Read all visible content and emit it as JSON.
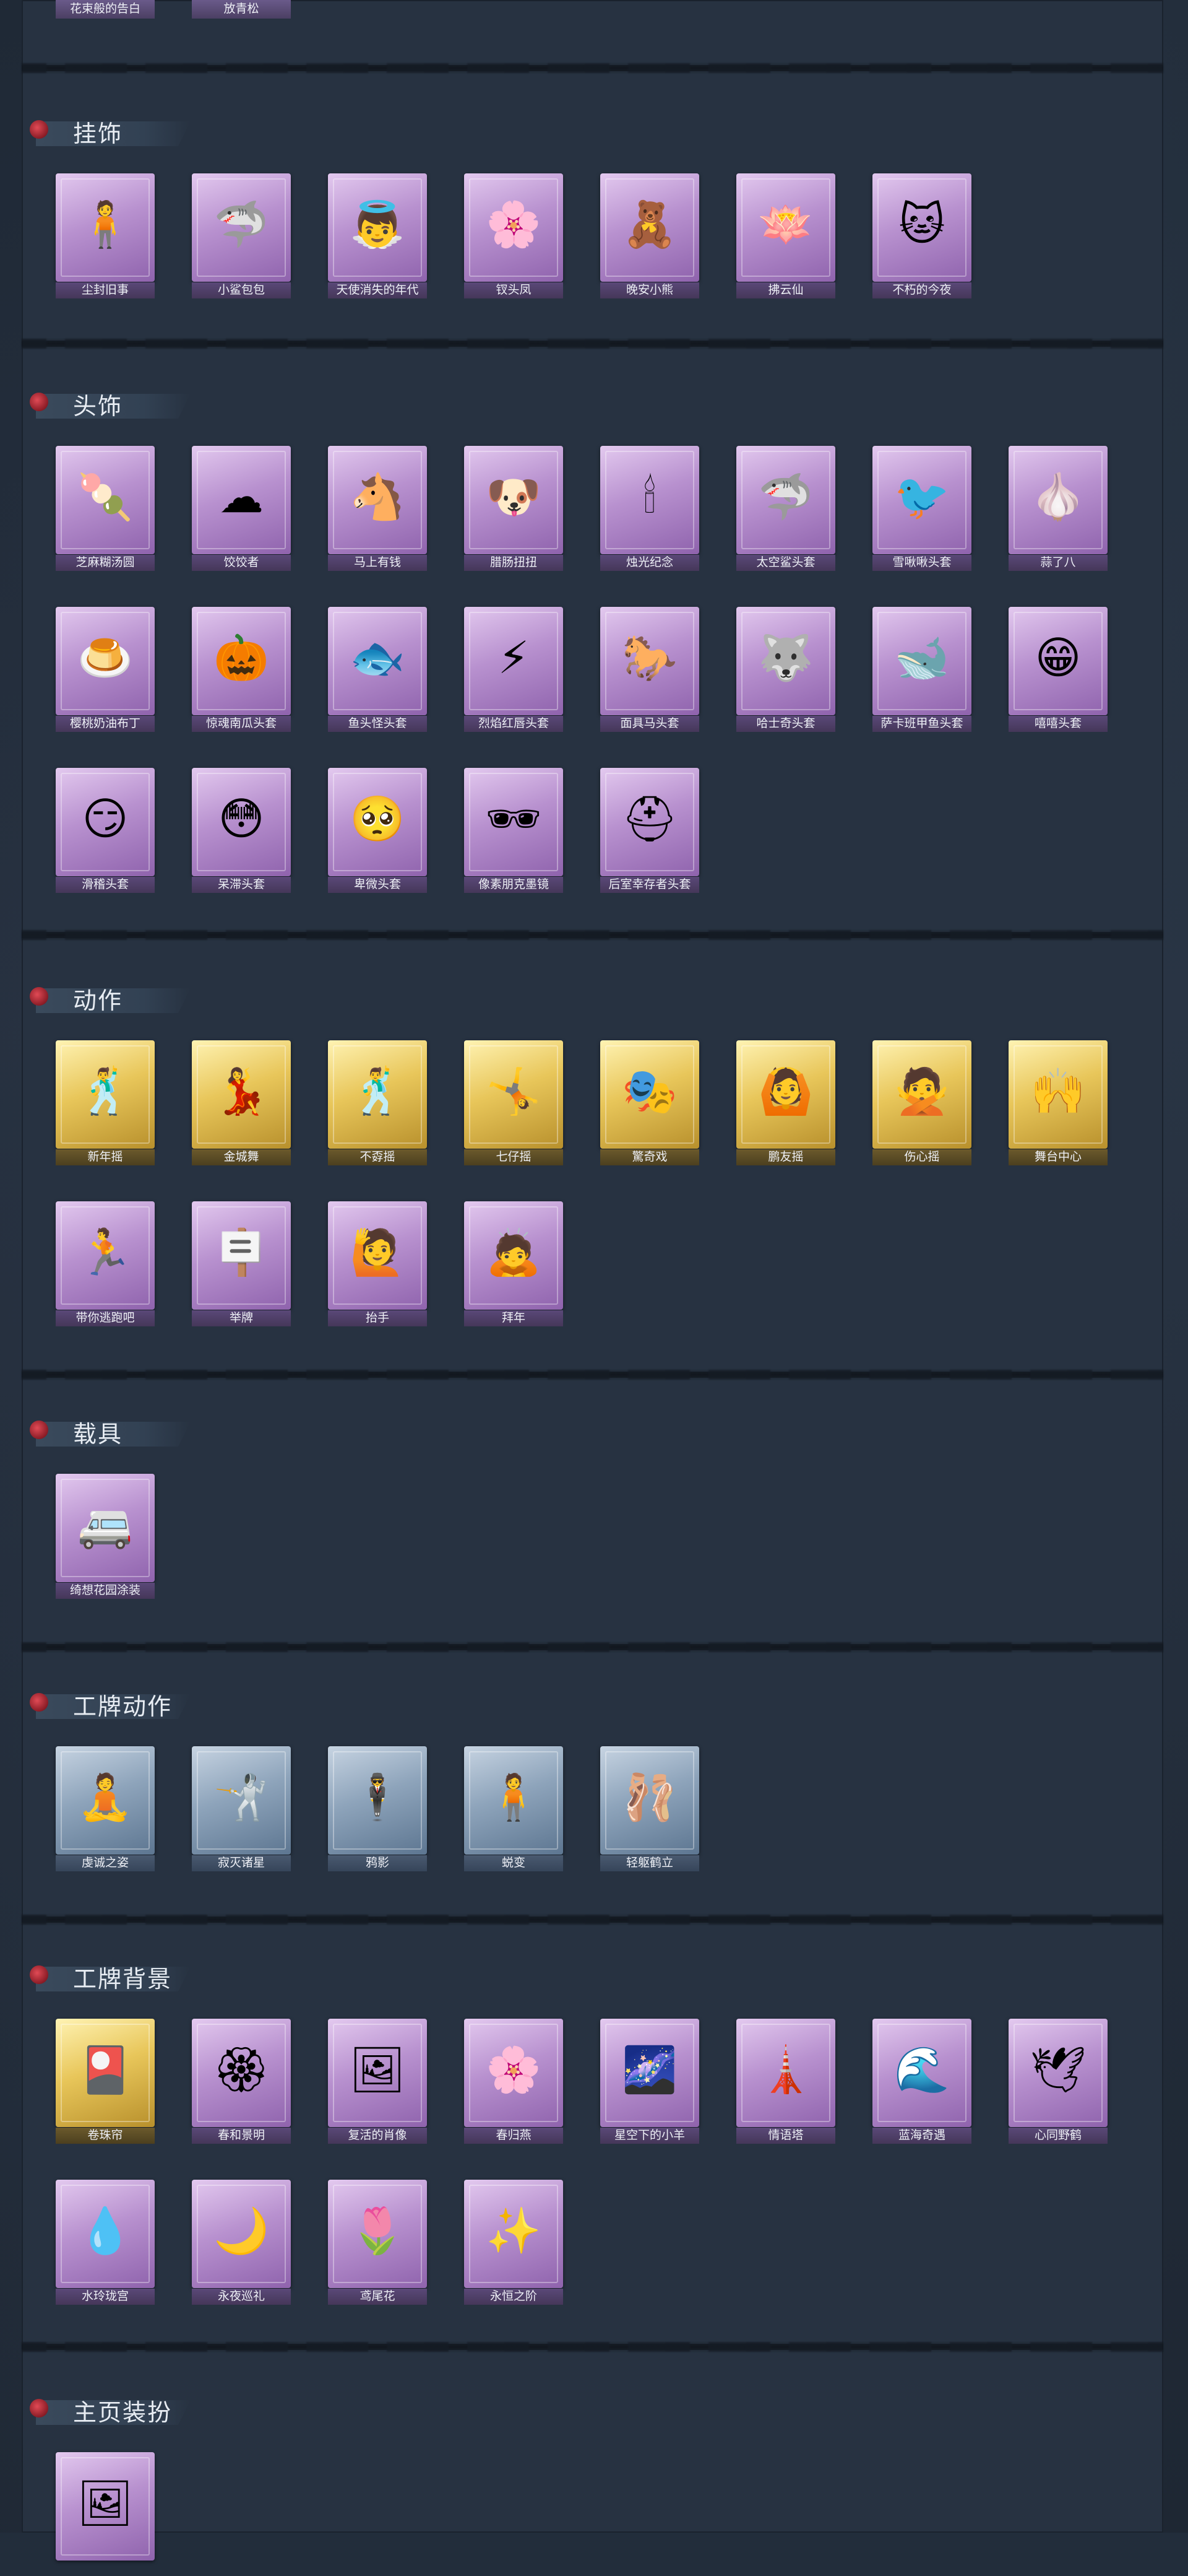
{
  "top_partial_labels": [
    "花束般的告白",
    "放青松"
  ],
  "sections": [
    {
      "title": "挂饰",
      "items": [
        {
          "label": "尘封旧事",
          "icon": "figure-charm-icon",
          "glyph": "🧍"
        },
        {
          "label": "小鲨包包",
          "icon": "shark-charm-icon",
          "glyph": "🦈"
        },
        {
          "label": "天使消失的年代",
          "icon": "angel-charm-icon",
          "glyph": "👼"
        },
        {
          "label": "钗头凤",
          "icon": "phoenix-charm-icon",
          "glyph": "🌸"
        },
        {
          "label": "晚安小熊",
          "icon": "bear-charm-icon",
          "glyph": "🧸"
        },
        {
          "label": "拂云仙",
          "icon": "immortal-charm-icon",
          "glyph": "🪷"
        },
        {
          "label": "不朽的今夜",
          "icon": "cat-charm-icon",
          "glyph": "🐱"
        }
      ]
    },
    {
      "title": "头饰",
      "items": [
        {
          "label": "芝麻糊汤圆",
          "icon": "dumpling-head-icon",
          "glyph": "🍡"
        },
        {
          "label": "饺饺者",
          "icon": "cloud-head-icon",
          "glyph": "☁"
        },
        {
          "label": "马上有钱",
          "icon": "horse-head-icon",
          "glyph": "🐴"
        },
        {
          "label": "腊肠扭扭",
          "icon": "dog-head-icon",
          "glyph": "🐶"
        },
        {
          "label": "烛光纪念",
          "icon": "candle-head-icon",
          "glyph": "🕯"
        },
        {
          "label": "太空鲨头套",
          "icon": "shark-head-icon",
          "glyph": "🦈"
        },
        {
          "label": "雪啾啾头套",
          "icon": "bird-head-icon",
          "glyph": "🐦"
        },
        {
          "label": "蒜了八",
          "icon": "garlic-head-icon",
          "glyph": "🧄"
        },
        {
          "label": "樱桃奶油布丁",
          "icon": "pudding-head-icon",
          "glyph": "🍮"
        },
        {
          "label": "惊魂南瓜头套",
          "icon": "pumpkin-head-icon",
          "glyph": "🎃"
        },
        {
          "label": "鱼头怪头套",
          "icon": "fish-head-icon",
          "glyph": "🐟"
        },
        {
          "label": "烈焰红唇头套",
          "icon": "pikachu-head-icon",
          "glyph": "⚡"
        },
        {
          "label": "面具马头套",
          "icon": "horse-mask-icon",
          "glyph": "🐎"
        },
        {
          "label": "哈士奇头套",
          "icon": "husky-head-icon",
          "glyph": "🐺"
        },
        {
          "label": "萨卡班甲鱼头套",
          "icon": "fish-mask-icon",
          "glyph": "🐋"
        },
        {
          "label": "嘻嘻头套",
          "icon": "grin-head-icon",
          "glyph": "😁"
        },
        {
          "label": "滑稽头套",
          "icon": "funny-face-icon",
          "glyph": "😏"
        },
        {
          "label": "呆滞头套",
          "icon": "dazed-face-icon",
          "glyph": "😳"
        },
        {
          "label": "卑微头套",
          "icon": "humble-face-icon",
          "glyph": "🥺"
        },
        {
          "label": "像素朋克墨镜",
          "icon": "pixel-sunglasses-icon",
          "glyph": "🕶"
        },
        {
          "label": "后室幸存者头套",
          "icon": "gas-mask-icon",
          "glyph": "⛑"
        }
      ]
    },
    {
      "title": "动作",
      "items": [
        {
          "label": "新年摇",
          "icon": "dance-pose-icon",
          "glyph": "🕺",
          "tier": "gold"
        },
        {
          "label": "金城舞",
          "icon": "dance-pose-icon",
          "glyph": "💃",
          "tier": "gold"
        },
        {
          "label": "不孬摇",
          "icon": "dance-pose-icon",
          "glyph": "🕺",
          "tier": "gold"
        },
        {
          "label": "七仔摇",
          "icon": "dance-pose-icon",
          "glyph": "🤸",
          "tier": "gold"
        },
        {
          "label": "驚奇戏",
          "icon": "dance-pose-icon",
          "glyph": "🎭",
          "tier": "gold"
        },
        {
          "label": "鹏友摇",
          "icon": "dance-pose-icon",
          "glyph": "🙆",
          "tier": "gold"
        },
        {
          "label": "伤心摇",
          "icon": "dance-pose-icon",
          "glyph": "🙅",
          "tier": "gold"
        },
        {
          "label": "舞台中心",
          "icon": "dance-pose-icon",
          "glyph": "🙌",
          "tier": "gold"
        },
        {
          "label": "带你逃跑吧",
          "icon": "run-pose-icon",
          "glyph": "🏃",
          "tier": "purple"
        },
        {
          "label": "举牌",
          "icon": "sign-pose-icon",
          "glyph": "🪧",
          "tier": "purple"
        },
        {
          "label": "抬手",
          "icon": "raise-hand-pose-icon",
          "glyph": "🙋",
          "tier": "purple"
        },
        {
          "label": "拜年",
          "icon": "bow-pose-icon",
          "glyph": "🙇",
          "tier": "purple"
        }
      ]
    },
    {
      "title": "载具",
      "items": [
        {
          "label": "绮想花园涂装",
          "icon": "vehicle-icon",
          "glyph": "🚐"
        }
      ]
    },
    {
      "title": "工牌动作",
      "items": [
        {
          "label": "虔诚之姿",
          "icon": "badge-pose-icon",
          "glyph": "🧘",
          "tier": "blue"
        },
        {
          "label": "寂灭诸星",
          "icon": "badge-pose-icon",
          "glyph": "🤺",
          "tier": "blue"
        },
        {
          "label": "鸦影",
          "icon": "badge-pose-icon",
          "glyph": "🕴",
          "tier": "blue"
        },
        {
          "label": "蜕变",
          "icon": "badge-pose-icon",
          "glyph": "🧍",
          "tier": "blue"
        },
        {
          "label": "轻躯鹤立",
          "icon": "badge-pose-icon",
          "glyph": "🩰",
          "tier": "blue"
        }
      ]
    },
    {
      "title": "工牌背景",
      "items": [
        {
          "label": "卷珠帘",
          "icon": "card-background-icon",
          "glyph": "🎴",
          "tier": "gold"
        },
        {
          "label": "春和景明",
          "icon": "card-background-icon",
          "glyph": "🏵",
          "tier": "purple"
        },
        {
          "label": "复活的肖像",
          "icon": "card-background-icon",
          "glyph": "🖼",
          "tier": "purple"
        },
        {
          "label": "春归燕",
          "icon": "card-background-icon",
          "glyph": "🌸",
          "tier": "purple"
        },
        {
          "label": "星空下的小羊",
          "icon": "card-background-icon",
          "glyph": "🌌",
          "tier": "purple"
        },
        {
          "label": "情语塔",
          "icon": "card-background-icon",
          "glyph": "🗼",
          "tier": "purple"
        },
        {
          "label": "蓝海奇遇",
          "icon": "card-background-icon",
          "glyph": "🌊",
          "tier": "purple"
        },
        {
          "label": "心同野鹤",
          "icon": "card-background-icon",
          "glyph": "🕊",
          "tier": "purple"
        },
        {
          "label": "水玲珑宫",
          "icon": "card-background-icon",
          "glyph": "💧",
          "tier": "purple"
        },
        {
          "label": "永夜巡礼",
          "icon": "card-background-icon",
          "glyph": "🌙",
          "tier": "purple"
        },
        {
          "label": "鸢尾花",
          "icon": "card-background-icon",
          "glyph": "🌷",
          "tier": "purple"
        },
        {
          "label": "永恒之阶",
          "icon": "card-background-icon",
          "glyph": "✨",
          "tier": "purple"
        }
      ]
    },
    {
      "title": "主页装扮",
      "items": [
        {
          "label": "",
          "icon": "homepage-decor-icon",
          "glyph": "🖼",
          "tier": "purple"
        }
      ]
    }
  ]
}
